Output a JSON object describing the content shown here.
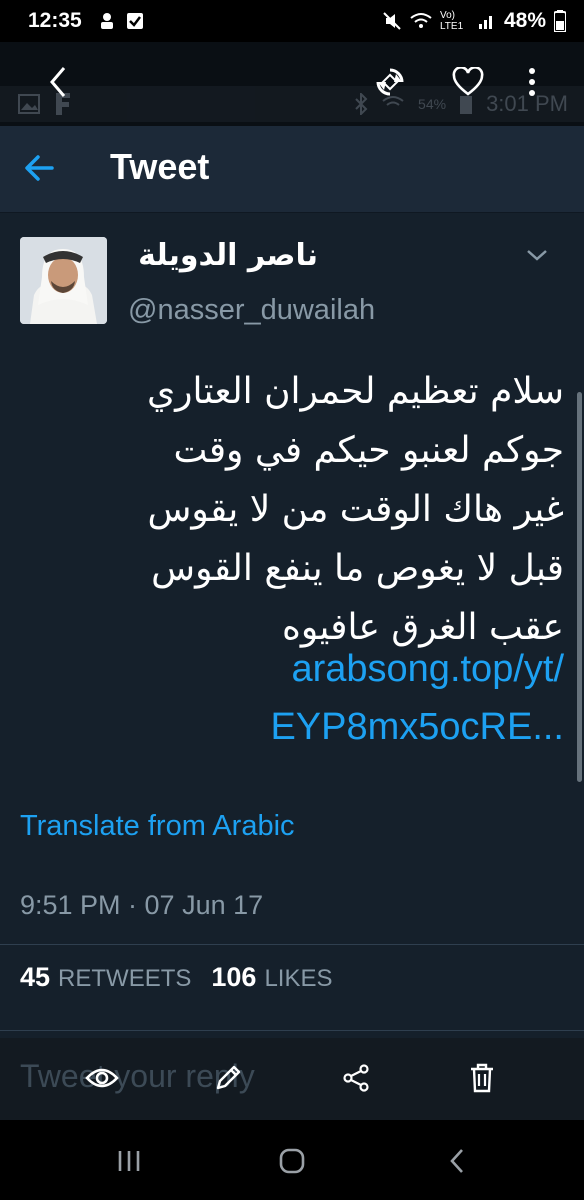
{
  "status_bar": {
    "time": "12:35",
    "battery": "48%",
    "network": "Vo) LTE1"
  },
  "ghost_status": {
    "battery": "54%",
    "time": "3:01 PM"
  },
  "header": {
    "title": "Tweet"
  },
  "tweet": {
    "author_name": "ناصر الدويلة",
    "author_handle": "@nasser_duwailah",
    "text": "سلام تعظيم لحمران العتاري\nجوكم لعنبو حيكم في وقت\nغير هاك الوقت من لا يقوس\nقبل لا يغوص ما ينفع القوس\nعقب الغرق عافيوه",
    "link": "arabsong.top/yt/\nEYP8mx5ocRE...",
    "translate_label": "Translate from Arabic",
    "timestamp": "9:51 PM · 07 Jun 17",
    "retweets_count": "45",
    "retweets_label": "RETWEETS",
    "likes_count": "106",
    "likes_label": "LIKES"
  },
  "reply": {
    "placeholder": "Tweet your reply"
  },
  "colors": {
    "background": "#15202b",
    "header": "#1c2938",
    "accent": "#1da1f2",
    "muted": "#8899a6"
  },
  "icons": [
    "back-arrow-icon",
    "rotate-icon",
    "heart-icon",
    "more-vert-icon",
    "chevron-down-icon",
    "eye-icon",
    "pencil-icon",
    "share-icon",
    "trash-icon",
    "recent-apps-icon",
    "home-icon",
    "nav-back-icon"
  ]
}
